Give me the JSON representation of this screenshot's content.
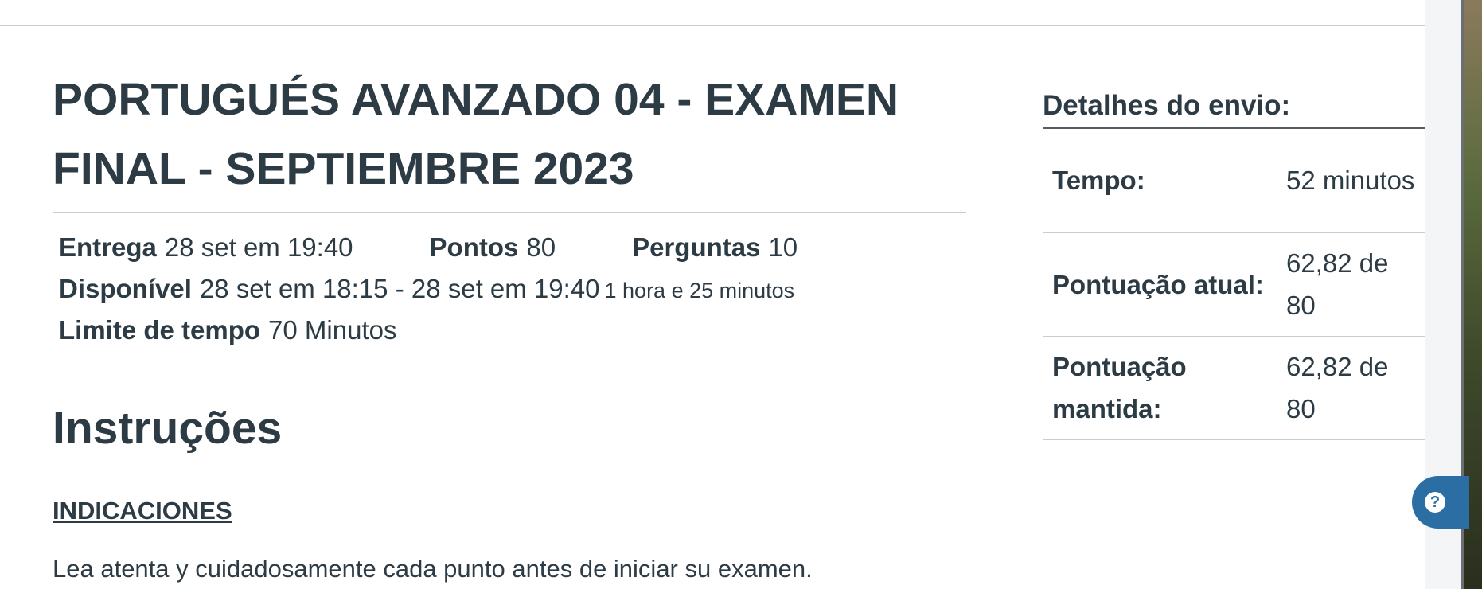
{
  "quiz": {
    "title": "PORTUGUÉS AVANZADO 04 - EXAMEN FINAL - SEPTIEMBRE 2023",
    "meta": {
      "due_label": "Entrega",
      "due_value": "28 set em 19:40",
      "points_label": "Pontos",
      "points_value": "80",
      "questions_label": "Perguntas",
      "questions_value": "10",
      "available_label": "Disponível",
      "available_value": "28 set em 18:15 - 28 set em 19:40",
      "available_duration": "1 hora e 25 minutos",
      "time_limit_label": "Limite de tempo",
      "time_limit_value": "70 Minutos"
    },
    "instructions_heading": "Instruções",
    "indications_heading": "INDICACIONES",
    "first_paragraph": "Lea atenta y cuidadosamente cada punto antes de iniciar su examen."
  },
  "submission": {
    "heading": "Detalhes do envio:",
    "rows": [
      {
        "label": "Tempo:",
        "value": "52 minutos"
      },
      {
        "label": "Pontuação atual:",
        "value": "62,82 de 80"
      },
      {
        "label": "Pontuação mantida:",
        "value": "62,82 de 80"
      }
    ]
  },
  "help": {
    "icon": "help-question-icon",
    "glyph": "?",
    "color": "#2b6ea4"
  }
}
